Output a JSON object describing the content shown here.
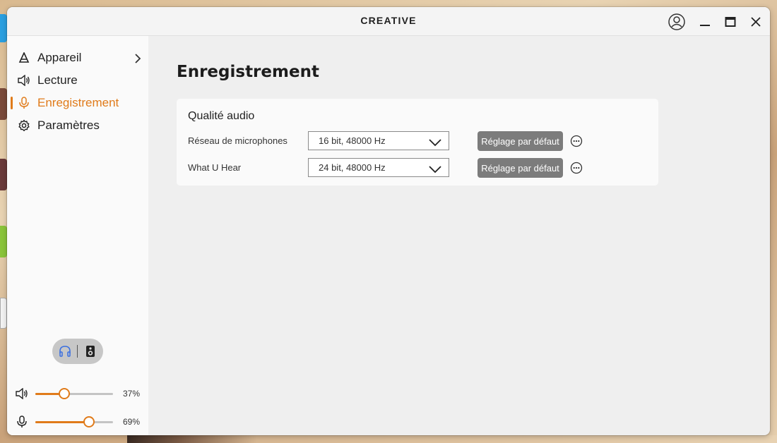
{
  "window": {
    "brand": "CREATIVE",
    "controls": [
      "user-icon",
      "minimize-icon",
      "maximize-icon",
      "close-icon"
    ]
  },
  "sidebar": {
    "items": [
      {
        "label": "Appareil",
        "icon": "device-icon",
        "has_submenu": true,
        "active": false
      },
      {
        "label": "Lecture",
        "icon": "speaker-icon",
        "has_submenu": false,
        "active": false
      },
      {
        "label": "Enregistrement",
        "icon": "microphone-icon",
        "has_submenu": false,
        "active": true
      },
      {
        "label": "Paramètres",
        "icon": "gear-icon",
        "has_submenu": false,
        "active": false
      }
    ],
    "output_toggle": {
      "options": [
        "headphones-icon",
        "speaker-box-icon"
      ],
      "selected": "headphones-icon"
    },
    "volume": {
      "icon": "speaker-icon",
      "value": 37,
      "label": "37%"
    },
    "mic_volume": {
      "icon": "microphone-icon",
      "value": 69,
      "label": "69%"
    }
  },
  "main": {
    "title": "Enregistrement",
    "card": {
      "title": "Qualité audio",
      "rows": [
        {
          "label": "Réseau de microphones",
          "select_value": "16 bit, 48000 Hz",
          "button_label": "Réglage par défaut"
        },
        {
          "label": "What U Hear",
          "select_value": "24 bit, 48000 Hz",
          "button_label": "Réglage par défaut"
        }
      ]
    }
  },
  "colors": {
    "accent": "#e07b1a",
    "button_gray": "#7c7c7c",
    "headphone_blue": "#3a6fe0"
  }
}
